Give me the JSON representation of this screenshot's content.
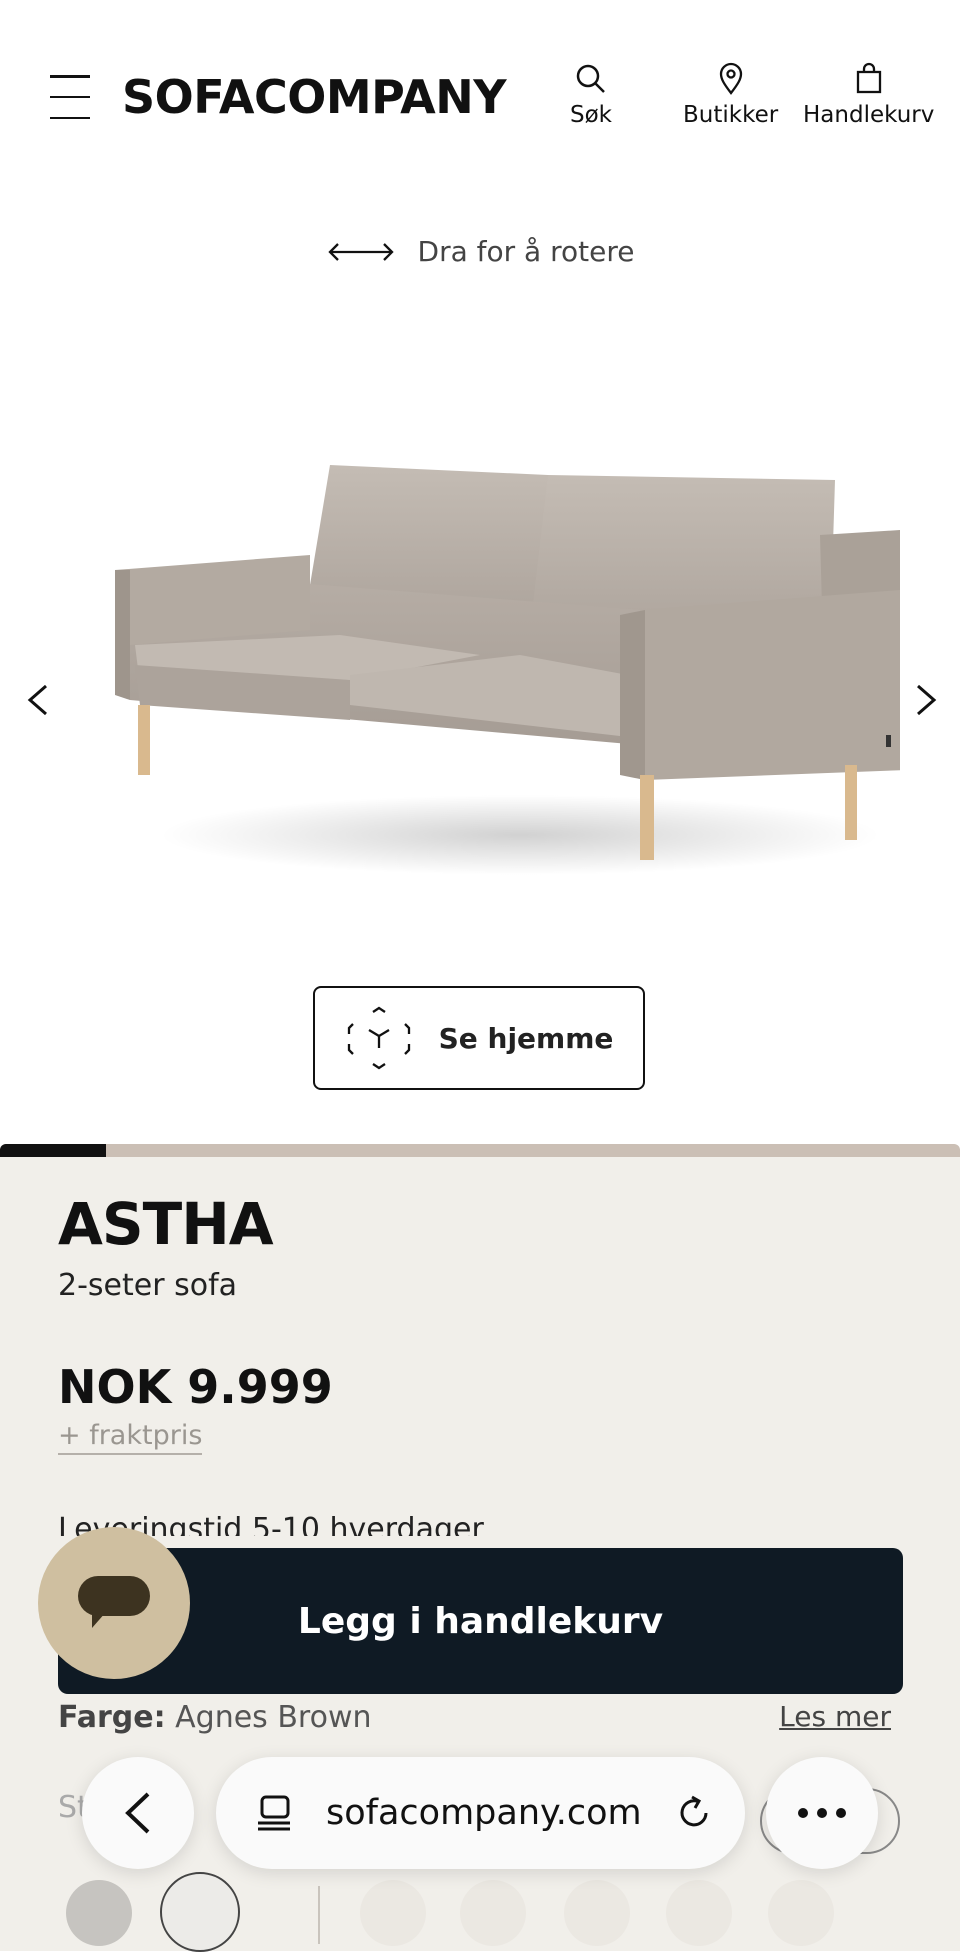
{
  "header": {
    "brand": "SOFACOMPANY",
    "search_label": "Søk",
    "stores_label": "Butikker",
    "cart_label": "Handlekurv"
  },
  "viewer": {
    "rotate_hint": "Dra for å rotere",
    "see_at_home_label": "Se hjemme",
    "gallery_progress": 0.11
  },
  "product": {
    "name": "ASTHA",
    "subtitle": "2-seter sofa",
    "price": "NOK 9.999",
    "shipping_link": "+ fraktpris",
    "delivery": "Leveringstid 5-10 hverdager",
    "add_to_cart_label": "Legg i handlekurv",
    "color_label": "Farge:",
    "color_value": "Agnes Brown",
    "read_more_label": "Les mer",
    "standard_label_partial": "St      l f"
  },
  "swatches": {
    "colors": [
      "#c6c4c0",
      "#ecebe8",
      "#f0eee9",
      "#f0eee9",
      "#f0eee9",
      "#f0eee9",
      "#f0eee9",
      "#f0eee9"
    ]
  },
  "browser": {
    "url": "sofacompany.com"
  },
  "colors": {
    "cart_button": "#0f1a24",
    "info_background": "#f1efea",
    "chat_button": "#cfbfa0",
    "progress_track": "#cbbfb5"
  }
}
